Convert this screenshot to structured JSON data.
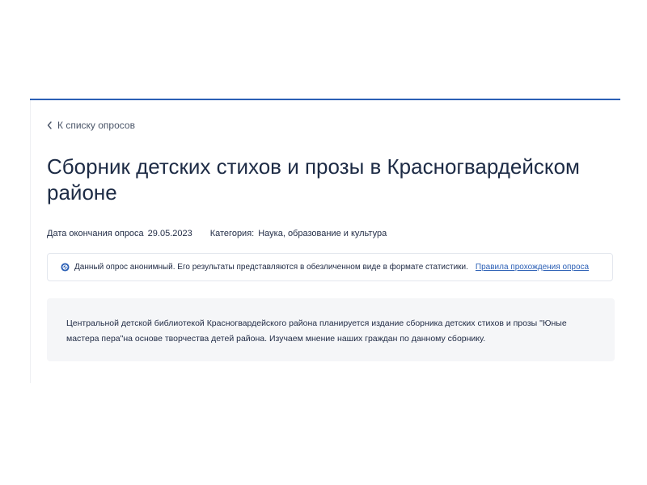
{
  "back_link": {
    "label": "К списку опросов",
    "icon": "chevron-left-icon"
  },
  "survey": {
    "title": "Сборник детских стихов и прозы в Красногвардейском районе",
    "end_date_label": "Дата окончания опроса",
    "end_date": "29.05.2023",
    "category_label": "Категория:",
    "category": "Наука, образование и культура"
  },
  "notice": {
    "icon": "anonymous-icon",
    "text": "Данный опрос анонимный. Его результаты представляются в обезличенном виде в формате статистики.",
    "link_label": "Правила прохождения опроса"
  },
  "description": {
    "text": "Центральной детской библиотекой Красногвардейского района планируется издание сборника детских стихов и прозы \"Юные мастера пера\"на основе творчества детей района. Изучаем мнение наших граждан по данному сборнику."
  },
  "colors": {
    "accent": "#2b5fb5",
    "text": "#1f2a44",
    "panel_bg": "#f5f6f8"
  }
}
